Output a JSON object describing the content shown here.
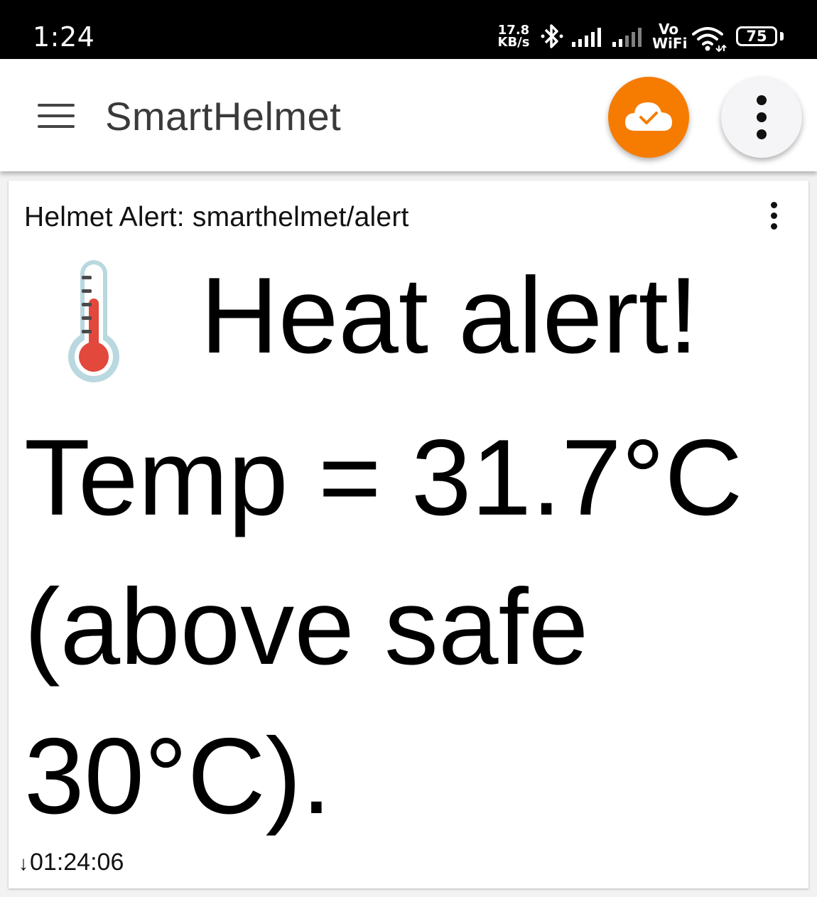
{
  "status_bar": {
    "time": "1:24",
    "network_speed_value": "17.8",
    "network_speed_unit": "KB/s",
    "vowifi_top": "Vo",
    "vowifi_bottom": "WiFi",
    "battery_level": "75",
    "icons": [
      "bluetooth-icon",
      "signal-icon",
      "signal-icon",
      "wifi-icon",
      "battery-icon"
    ]
  },
  "app_bar": {
    "title": "SmartHelmet",
    "menu_icon": "hamburger-menu-icon",
    "connection_icon": "cloud-check-icon",
    "overflow_icon": "vertical-dots-icon",
    "accent_color": "#f57c00"
  },
  "card": {
    "title": "Helmet Alert: smarthelmet/alert",
    "alert_heading": "Heat alert!",
    "alert_body": "Temp = 31.7°C (above safe 30°C).",
    "timestamp_arrow": "↓",
    "timestamp": "01:24:06",
    "emoji_icon": "thermometer-icon"
  }
}
